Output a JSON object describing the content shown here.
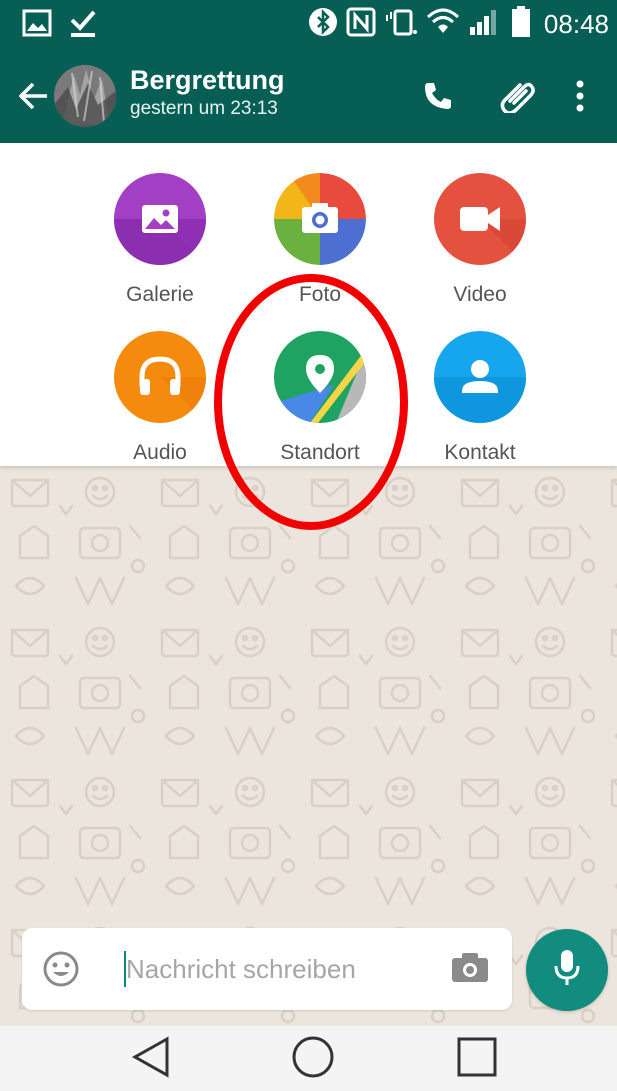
{
  "status_bar": {
    "time": "08:48",
    "icons": [
      "image-icon",
      "download-check-icon",
      "bluetooth-icon",
      "nfc-icon",
      "vibrate-icon",
      "wifi-icon",
      "signal-icon",
      "battery-icon"
    ]
  },
  "header": {
    "contact_name": "Bergrettung",
    "last_seen": "gestern um 23:13",
    "icons": [
      "back-arrow-icon",
      "avatar",
      "phone-icon",
      "paperclip-icon",
      "more-vert-icon"
    ]
  },
  "attach_menu": {
    "items": [
      {
        "label": "Galerie",
        "icon": "gallery-icon",
        "color": "#a33fc4"
      },
      {
        "label": "Foto",
        "icon": "camera-icon",
        "color": "#e84b3c"
      },
      {
        "label": "Video",
        "icon": "video-icon",
        "color": "#e5513f"
      },
      {
        "label": "Audio",
        "icon": "headphones-icon",
        "color": "#f58b0e"
      },
      {
        "label": "Standort",
        "icon": "location-pin-icon",
        "color": "#1ea362"
      },
      {
        "label": "Kontakt",
        "icon": "contact-person-icon",
        "color": "#16a6ef"
      }
    ]
  },
  "composer": {
    "placeholder": "Nachricht schreiben",
    "value": ""
  },
  "colors": {
    "primary": "#075e54",
    "accent": "#128c7e",
    "chat_bg": "#ece5dd",
    "highlight": "#f20000"
  }
}
